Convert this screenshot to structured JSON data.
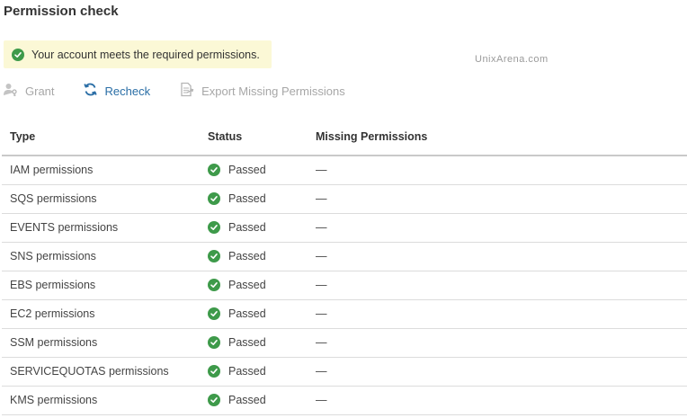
{
  "page": {
    "title": "Permission check",
    "alert_text": "Your account meets the required permissions.",
    "watermark": "UnixArena.com"
  },
  "toolbar": {
    "grant_label": "Grant",
    "recheck_label": "Recheck",
    "export_label": "Export Missing Permissions"
  },
  "table": {
    "headers": [
      "Type",
      "Status",
      "Missing Permissions"
    ],
    "rows": [
      {
        "type": "IAM permissions",
        "status": "Passed",
        "missing": "—"
      },
      {
        "type": "SQS permissions",
        "status": "Passed",
        "missing": "—"
      },
      {
        "type": "EVENTS permissions",
        "status": "Passed",
        "missing": "—"
      },
      {
        "type": "SNS permissions",
        "status": "Passed",
        "missing": "—"
      },
      {
        "type": "EBS permissions",
        "status": "Passed",
        "missing": "—"
      },
      {
        "type": "EC2 permissions",
        "status": "Passed",
        "missing": "—"
      },
      {
        "type": "SSM permissions",
        "status": "Passed",
        "missing": "—"
      },
      {
        "type": "SERVICEQUOTAS permissions",
        "status": "Passed",
        "missing": "—"
      },
      {
        "type": "KMS permissions",
        "status": "Passed",
        "missing": "—"
      }
    ]
  },
  "colors": {
    "success": "#3e9a4a",
    "alert_bg": "#fbf8d6",
    "link": "#2a6ea6",
    "disabled": "#a7a7a7"
  },
  "icons": {
    "alert": "check-circle-icon",
    "grant": "user-key-icon",
    "recheck": "refresh-icon",
    "export": "export-document-icon",
    "status": "check-circle-icon"
  }
}
